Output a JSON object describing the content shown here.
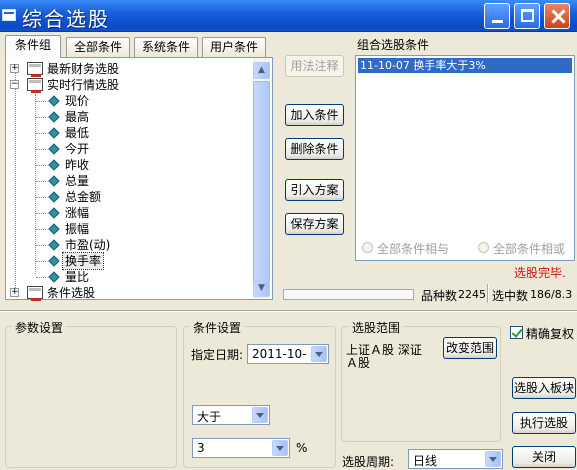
{
  "window": {
    "title": "综合选股"
  },
  "tabs": [
    "条件组",
    "全部条件",
    "系统条件",
    "用户条件"
  ],
  "tree": {
    "groups": [
      "最新财务选股",
      "实时行情选股",
      "条件选股"
    ],
    "items": [
      "现价",
      "最高",
      "最低",
      "今开",
      "昨收",
      "总量",
      "总金额",
      "涨幅",
      "振幅",
      "市盈(动)",
      "换手率",
      "量比"
    ],
    "selected": "换手率"
  },
  "buttons": {
    "usage": "用法注释",
    "add": "加入条件",
    "delete": "删除条件",
    "import": "引入方案",
    "save": "保存方案",
    "add_to_block": "选股入板块",
    "execute": "执行选股",
    "close": "关闭",
    "change_range": "改变范围"
  },
  "conditions": {
    "label": "组合选股条件",
    "items": [
      "11-10-07  换手率大于3%"
    ]
  },
  "logic": {
    "and_label": "全部条件相与",
    "or_label": "全部条件相或"
  },
  "status": {
    "message": "选股完毕.",
    "message_color": "#d01010",
    "count_label": "品种数",
    "count_value": "2245",
    "selected_label": "选中数",
    "selected_value": "186/8.3"
  },
  "params": {
    "label": "参数设置"
  },
  "condition_settings": {
    "label": "条件设置",
    "date_label": "指定日期:",
    "date_value": "2011-10-",
    "operator": "大于",
    "value": "3",
    "unit": "%"
  },
  "range": {
    "label": "选股范围",
    "line1": "上证Ａ股  深证",
    "line2": "Ａ股"
  },
  "options": {
    "adjust_label": "精确复权",
    "adjust_checked": true
  },
  "period": {
    "label": "选股周期:",
    "value": "日线"
  },
  "icons": [
    "app-icon",
    "minimize-icon",
    "maximize-icon",
    "close-icon",
    "folder-icon",
    "diamond-icon",
    "scroll-up-icon",
    "scroll-down-icon",
    "dropdown-arrow-icon"
  ]
}
